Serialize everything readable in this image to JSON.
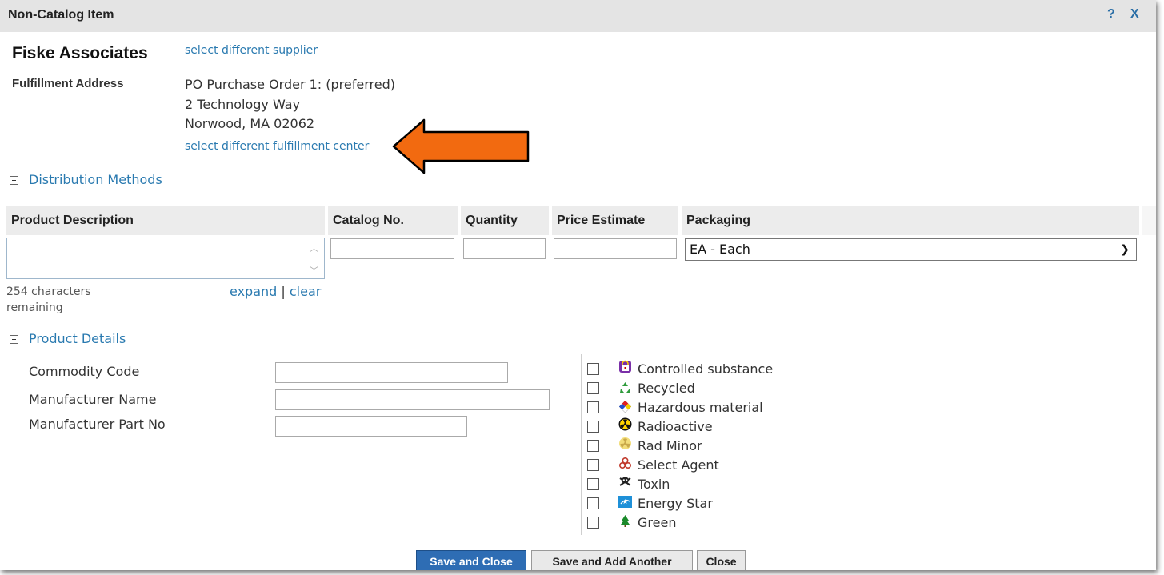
{
  "dialog": {
    "title": "Non-Catalog Item",
    "help_label": "?",
    "close_label": "X"
  },
  "supplier": {
    "name": "Fiske Associates",
    "select_link": "select different supplier"
  },
  "fulfillment": {
    "label": "Fulfillment Address",
    "lines": [
      "PO Purchase Order 1: (preferred)",
      "2 Technology Way",
      "Norwood, MA 02062"
    ],
    "select_link": "select different fulfillment center"
  },
  "distribution": {
    "label": "Distribution Methods"
  },
  "columns": {
    "product_description": "Product Description",
    "catalog_no": "Catalog No.",
    "quantity": "Quantity",
    "price_estimate": "Price Estimate",
    "packaging": "Packaging"
  },
  "inputs": {
    "product_description": "",
    "catalog_no": "",
    "quantity": "",
    "price_estimate": "",
    "packaging_selected": "EA - Each"
  },
  "description_meta": {
    "chars_remaining": "254 characters remaining",
    "expand": "expand",
    "separator": "|",
    "clear": "clear"
  },
  "product_details": {
    "label": "Product Details",
    "fields": [
      {
        "label": "Commodity Code",
        "value": ""
      },
      {
        "label": "Manufacturer Name",
        "value": ""
      },
      {
        "label": "Manufacturer Part No",
        "value": ""
      }
    ],
    "flags": [
      {
        "label": "Controlled substance",
        "icon": "controlled-substance-icon",
        "checked": false
      },
      {
        "label": "Recycled",
        "icon": "recycled-icon",
        "checked": false
      },
      {
        "label": "Hazardous material",
        "icon": "hazardous-material-icon",
        "checked": false
      },
      {
        "label": "Radioactive",
        "icon": "radioactive-icon",
        "checked": false
      },
      {
        "label": "Rad Minor",
        "icon": "rad-minor-icon",
        "checked": false
      },
      {
        "label": "Select Agent",
        "icon": "select-agent-icon",
        "checked": false
      },
      {
        "label": "Toxin",
        "icon": "toxin-icon",
        "checked": false
      },
      {
        "label": "Energy Star",
        "icon": "energy-star-icon",
        "checked": false
      },
      {
        "label": "Green",
        "icon": "green-icon",
        "checked": false
      }
    ]
  },
  "buttons": {
    "save_close": "Save and Close",
    "save_add": "Save and Add Another",
    "close": "Close"
  },
  "colors": {
    "link": "#2a7ab0",
    "primary_button": "#2e6db4",
    "annotation_arrow": "#f26a10"
  }
}
